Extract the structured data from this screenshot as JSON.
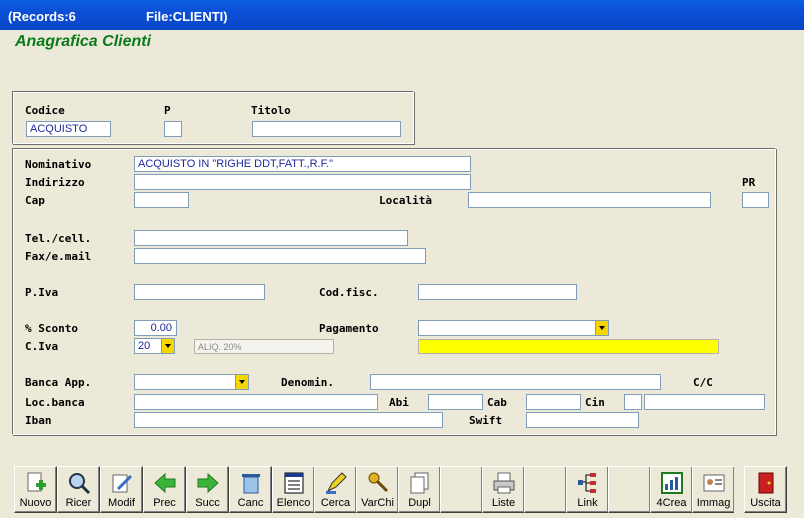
{
  "window": {
    "records": "(Records:6",
    "file": "File:CLIENTI)"
  },
  "form": {
    "title": "Anagrafica Clienti",
    "labels": {
      "codice": "Codice",
      "p": "P",
      "titolo": "Titolo",
      "nominativo": "Nominativo",
      "indirizzo": "Indirizzo",
      "pr": "PR",
      "cap": "Cap",
      "localita": "Località",
      "tel": "Tel./cell.",
      "fax": "Fax/e.mail",
      "piva": "P.Iva",
      "codfisc": "Cod.fisc.",
      "sconto": "% Sconto",
      "pagamento": "Pagamento",
      "civa": "C.Iva",
      "banca": "Banca App.",
      "denomin": "Denomin.",
      "cc": "C/C",
      "locbanca": "Loc.banca",
      "abi": "Abi",
      "cab": "Cab",
      "cin": "Cin",
      "iban": "Iban",
      "swift": "Swift"
    },
    "values": {
      "codice": "ACQUISTO",
      "p": "",
      "titolo": "",
      "nominativo": "ACQUISTO IN \"RIGHE DDT,FATT.,R.F.\"",
      "indirizzo": "",
      "pr": "",
      "cap": "",
      "localita": "",
      "tel": "",
      "fax": "",
      "piva": "",
      "codfisc": "",
      "sconto": "0.00",
      "pagamento": "",
      "civa": "20",
      "aliq": "ALIQ. 20%",
      "iva_desc": "",
      "banca": "",
      "denomin": "",
      "cc": "",
      "locbanca": "",
      "abi": "",
      "cab": "",
      "cin": "",
      "ccnum": "",
      "iban": "",
      "swift": ""
    },
    "highlight_color": "#ffff00"
  },
  "toolbar": [
    {
      "label": "Nuovo",
      "icon": "new-document-icon"
    },
    {
      "label": "Ricer",
      "icon": "search-icon"
    },
    {
      "label": "Modif",
      "icon": "edit-icon"
    },
    {
      "label": "Prec",
      "icon": "arrow-left-icon"
    },
    {
      "label": "Succ",
      "icon": "arrow-right-icon"
    },
    {
      "label": "Canc",
      "icon": "trash-icon"
    },
    {
      "label": "Elenco",
      "icon": "list-icon"
    },
    {
      "label": "Cerca",
      "icon": "highlighter-icon"
    },
    {
      "label": "VarChi",
      "icon": "keys-icon"
    },
    {
      "label": "Dupl",
      "icon": "duplicate-icon"
    },
    {
      "label": "",
      "icon": ""
    },
    {
      "label": "Liste",
      "icon": "printer-icon"
    },
    {
      "label": "",
      "icon": ""
    },
    {
      "label": "Link",
      "icon": "tree-icon"
    },
    {
      "label": "",
      "icon": ""
    },
    {
      "label": "4Crea",
      "icon": "chart-icon"
    },
    {
      "label": "Immag",
      "icon": "id-card-icon"
    },
    {
      "label": "",
      "icon": ""
    },
    {
      "label": "Uscita",
      "icon": "exit-door-icon"
    }
  ]
}
